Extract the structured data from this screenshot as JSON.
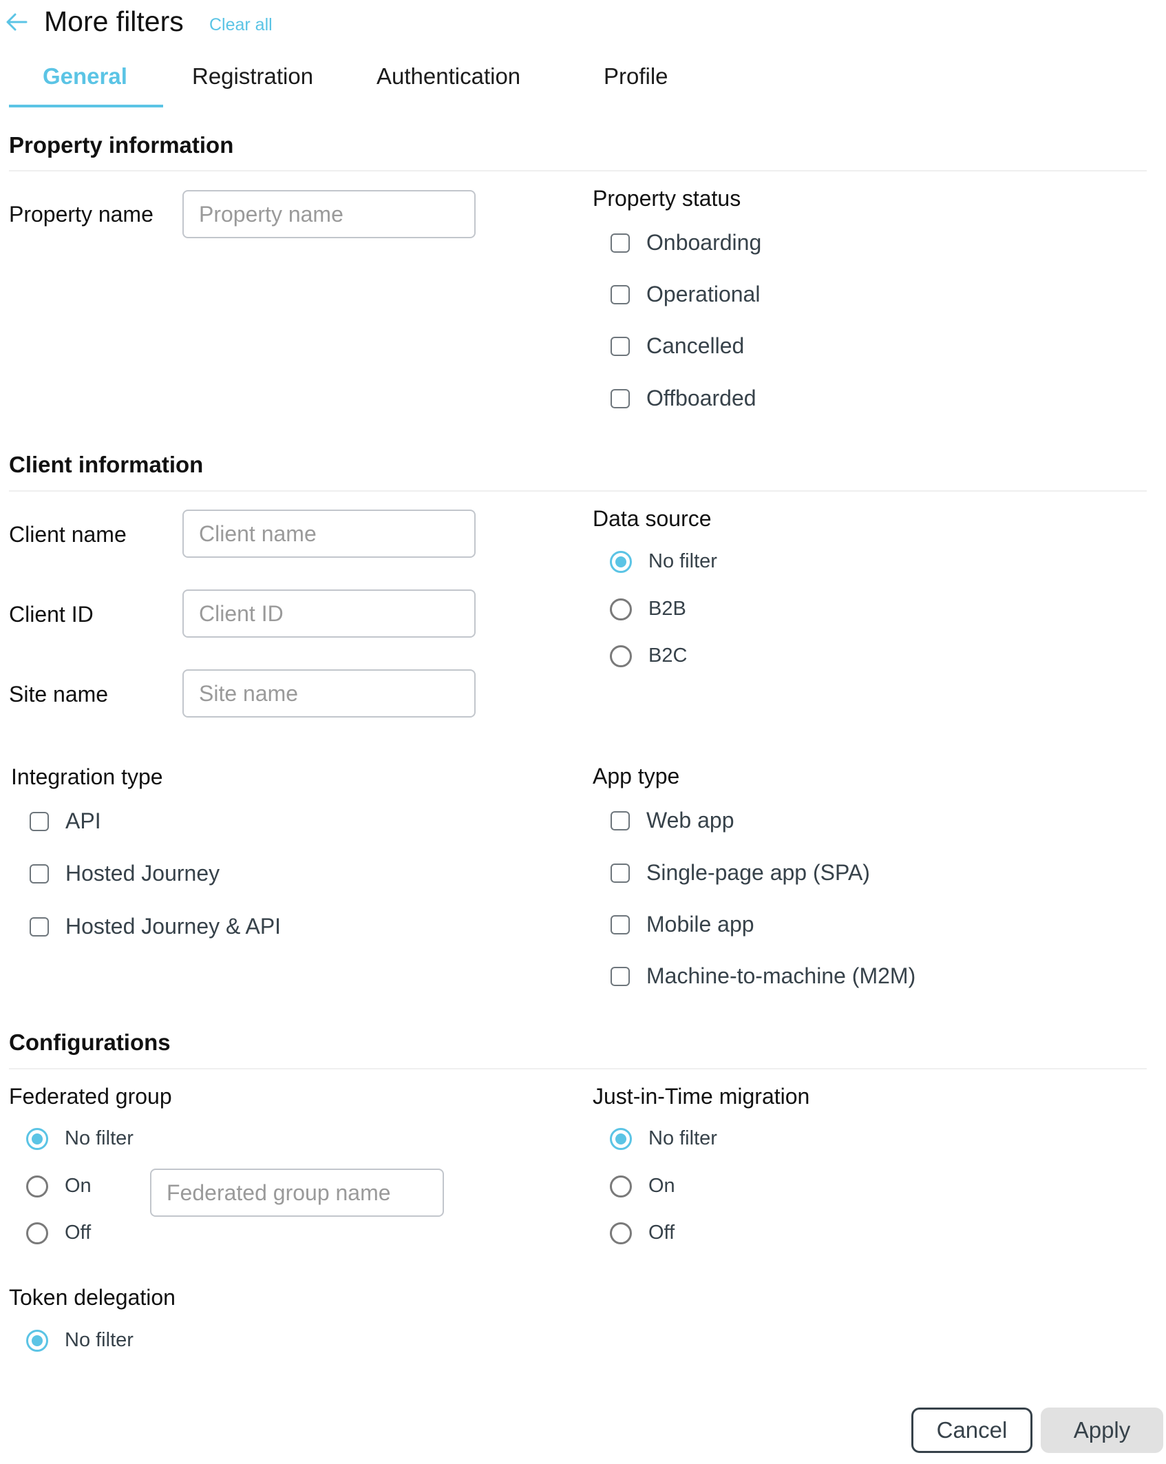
{
  "header": {
    "back_icon": "arrow-left-icon",
    "title": "More filters",
    "clear_all_label": "Clear all"
  },
  "tabs": [
    {
      "label": "General",
      "active": true
    },
    {
      "label": "Registration",
      "active": false
    },
    {
      "label": "Authentication",
      "active": false
    },
    {
      "label": "Profile",
      "active": false
    }
  ],
  "property_information": {
    "title": "Property information",
    "property_name": {
      "label": "Property name",
      "value": "",
      "placeholder": "Property name"
    },
    "property_status": {
      "label": "Property status",
      "options": [
        {
          "label": "Onboarding",
          "checked": false
        },
        {
          "label": "Operational",
          "checked": false
        },
        {
          "label": "Cancelled",
          "checked": false
        },
        {
          "label": "Offboarded",
          "checked": false
        }
      ]
    }
  },
  "client_information": {
    "title": "Client information",
    "client_name": {
      "label": "Client name",
      "value": "",
      "placeholder": "Client name"
    },
    "client_id": {
      "label": "Client ID",
      "value": "",
      "placeholder": "Client ID"
    },
    "site_name": {
      "label": "Site name",
      "value": "",
      "placeholder": "Site name"
    },
    "data_source": {
      "label": "Data source",
      "selected": "No filter",
      "options": [
        {
          "label": "No filter",
          "selected": true
        },
        {
          "label": "B2B",
          "selected": false
        },
        {
          "label": "B2C",
          "selected": false
        }
      ]
    },
    "integration_type": {
      "label": "Integration type",
      "options": [
        {
          "label": "API",
          "checked": false
        },
        {
          "label": "Hosted Journey",
          "checked": false
        },
        {
          "label": "Hosted Journey & API",
          "checked": false
        }
      ]
    },
    "app_type": {
      "label": "App type",
      "options": [
        {
          "label": "Web app",
          "checked": false
        },
        {
          "label": "Single-page app (SPA)",
          "checked": false
        },
        {
          "label": "Mobile app",
          "checked": false
        },
        {
          "label": "Machine-to-machine (M2M)",
          "checked": false
        }
      ]
    }
  },
  "configurations": {
    "title": "Configurations",
    "federated_group": {
      "label": "Federated group",
      "selected": "No filter",
      "options": [
        {
          "label": "No filter",
          "selected": true
        },
        {
          "label": "On",
          "selected": false
        },
        {
          "label": "Off",
          "selected": false
        }
      ],
      "name_input": {
        "value": "",
        "placeholder": "Federated group name"
      }
    },
    "jit_migration": {
      "label": "Just-in-Time migration",
      "selected": "No filter",
      "options": [
        {
          "label": "No filter",
          "selected": true
        },
        {
          "label": "On",
          "selected": false
        },
        {
          "label": "Off",
          "selected": false
        }
      ]
    },
    "token_delegation": {
      "label": "Token delegation",
      "selected": "No filter",
      "options": [
        {
          "label": "No filter",
          "selected": true
        }
      ]
    }
  },
  "footer": {
    "cancel_label": "Cancel",
    "apply_label": "Apply"
  },
  "colors": {
    "accent": "#5bc4e5",
    "text_dark": "#111111",
    "option_text": "#37424a",
    "apply_bg": "#e1e1e1"
  }
}
